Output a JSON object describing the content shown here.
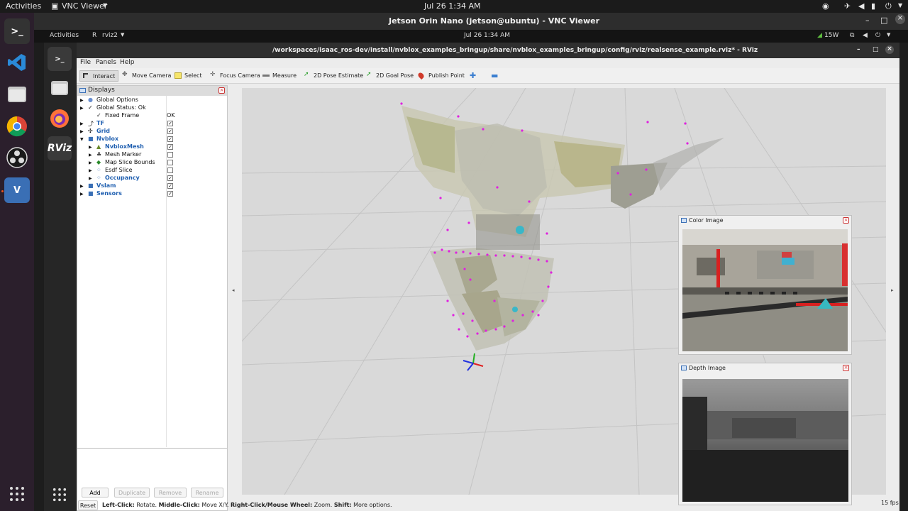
{
  "outer_topbar": {
    "activities": "Activities",
    "app_menu": "VNC Viewer",
    "clock": "Jul 26  1:34 AM"
  },
  "vnc_window": {
    "title": "Jetson Orin Nano (jetson@ubuntu) - VNC Viewer"
  },
  "inner_topbar": {
    "activities": "Activities",
    "app_menu": "rviz2",
    "clock": "Jul 26  1:34 AM",
    "power": "15W"
  },
  "rviz": {
    "window_title": "/workspaces/isaac_ros-dev/install/nvblox_examples_bringup/share/nvblox_examples_bringup/config/rviz/realsense_example.rviz* - RViz",
    "menu": [
      "File",
      "Panels",
      "Help"
    ],
    "tools": [
      {
        "label": "Interact",
        "icon": "cursor-icon"
      },
      {
        "label": "Move Camera",
        "icon": "move-camera-icon"
      },
      {
        "label": "Select",
        "icon": "select-icon"
      },
      {
        "label": "Focus Camera",
        "icon": "focus-camera-icon"
      },
      {
        "label": "Measure",
        "icon": "ruler-icon"
      },
      {
        "label": "2D Pose Estimate",
        "icon": "pose-estimate-icon"
      },
      {
        "label": "2D Goal Pose",
        "icon": "goal-pose-icon"
      },
      {
        "label": "Publish Point",
        "icon": "publish-point-icon"
      }
    ],
    "displays": {
      "title": "Displays",
      "rows": [
        {
          "label": "Global Options",
          "value": ""
        },
        {
          "label": "Global Status: Ok",
          "value": ""
        },
        {
          "label": "Fixed Frame",
          "value": "OK"
        },
        {
          "label": "TF",
          "value": ""
        },
        {
          "label": "Grid",
          "value": ""
        },
        {
          "label": "Nvblox",
          "value": ""
        },
        {
          "label": "NvbloxMesh",
          "value": ""
        },
        {
          "label": "Mesh Marker",
          "value": ""
        },
        {
          "label": "Map Slice Bounds",
          "value": ""
        },
        {
          "label": "Esdf Slice",
          "value": ""
        },
        {
          "label": "Occupancy",
          "value": ""
        },
        {
          "label": "Vslam",
          "value": ""
        },
        {
          "label": "Sensors",
          "value": ""
        }
      ],
      "buttons": [
        "Add",
        "Duplicate",
        "Remove",
        "Rename"
      ]
    },
    "color_image_title": "Color Image",
    "depth_image_title": "Depth Image",
    "status": {
      "reset": "Reset",
      "left_click": "Left-Click:",
      "left_click_desc": "Rotate.",
      "middle_click": "Middle-Click:",
      "middle_click_desc": "Move X/Y.",
      "right_click": "Right-Click/Mouse Wheel:",
      "right_click_desc": "Zoom.",
      "shift": "Shift:",
      "shift_desc": "More options.",
      "fps": "15 fps"
    }
  },
  "colors": {
    "ubuntu_dock": "#2b1f2c",
    "point_magenta": "#e020e0",
    "rviz_grid": "#d8d8d8"
  }
}
